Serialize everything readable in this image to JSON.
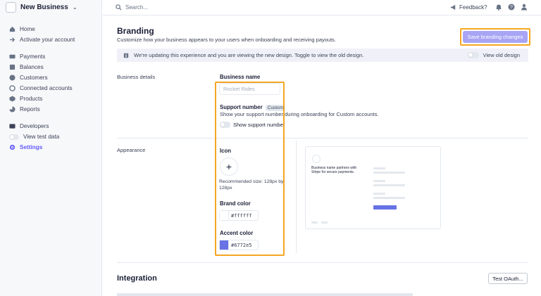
{
  "sidebar": {
    "business_name": "New Business",
    "items": [
      {
        "label": "Home",
        "icon": "home-icon"
      },
      {
        "label": "Activate your account",
        "icon": "arrow-right-icon"
      },
      {
        "label": "Payments",
        "icon": "card-icon"
      },
      {
        "label": "Balances",
        "icon": "balance-icon"
      },
      {
        "label": "Customers",
        "icon": "customer-icon"
      },
      {
        "label": "Connected accounts",
        "icon": "connected-icon"
      },
      {
        "label": "Products",
        "icon": "box-icon"
      },
      {
        "label": "Reports",
        "icon": "chart-icon"
      },
      {
        "label": "Developers",
        "icon": "terminal-icon"
      },
      {
        "label": "View test data",
        "icon": "toggle-icon"
      },
      {
        "label": "Settings",
        "icon": "gear-icon"
      }
    ]
  },
  "topbar": {
    "search_placeholder": "Search...",
    "feedback_label": "Feedback?"
  },
  "page": {
    "title": "Branding",
    "subtitle": "Customize how your business appears to your users when onboarding and receiving payouts.",
    "save_label": "Save branding changes",
    "notice": "We're updating this experience and you are viewing the new design. Toggle to view the old design.",
    "view_old_label": "View old design"
  },
  "business_details": {
    "section_label": "Business details",
    "name_label": "Business name",
    "name_placeholder": "Rocket Rides",
    "support_label": "Support number",
    "support_badge": "Custom",
    "support_desc": "Show your support number during onboarding for Custom accounts.",
    "support_toggle_label": "Show support number"
  },
  "appearance": {
    "section_label": "Appearance",
    "icon_label": "Icon",
    "icon_hint": "Recommended size: 128px by 128px",
    "brand_color_label": "Brand color",
    "brand_color": "#ffffff",
    "accent_color_label": "Accent color",
    "accent_color": "#6772e5",
    "preview_text": "Business name partners with Stripe for secure payments."
  },
  "integration": {
    "title": "Integration",
    "test_button": "Test OAuth..."
  },
  "colors": {
    "accent": "#635bff",
    "highlight": "#f5a623"
  }
}
